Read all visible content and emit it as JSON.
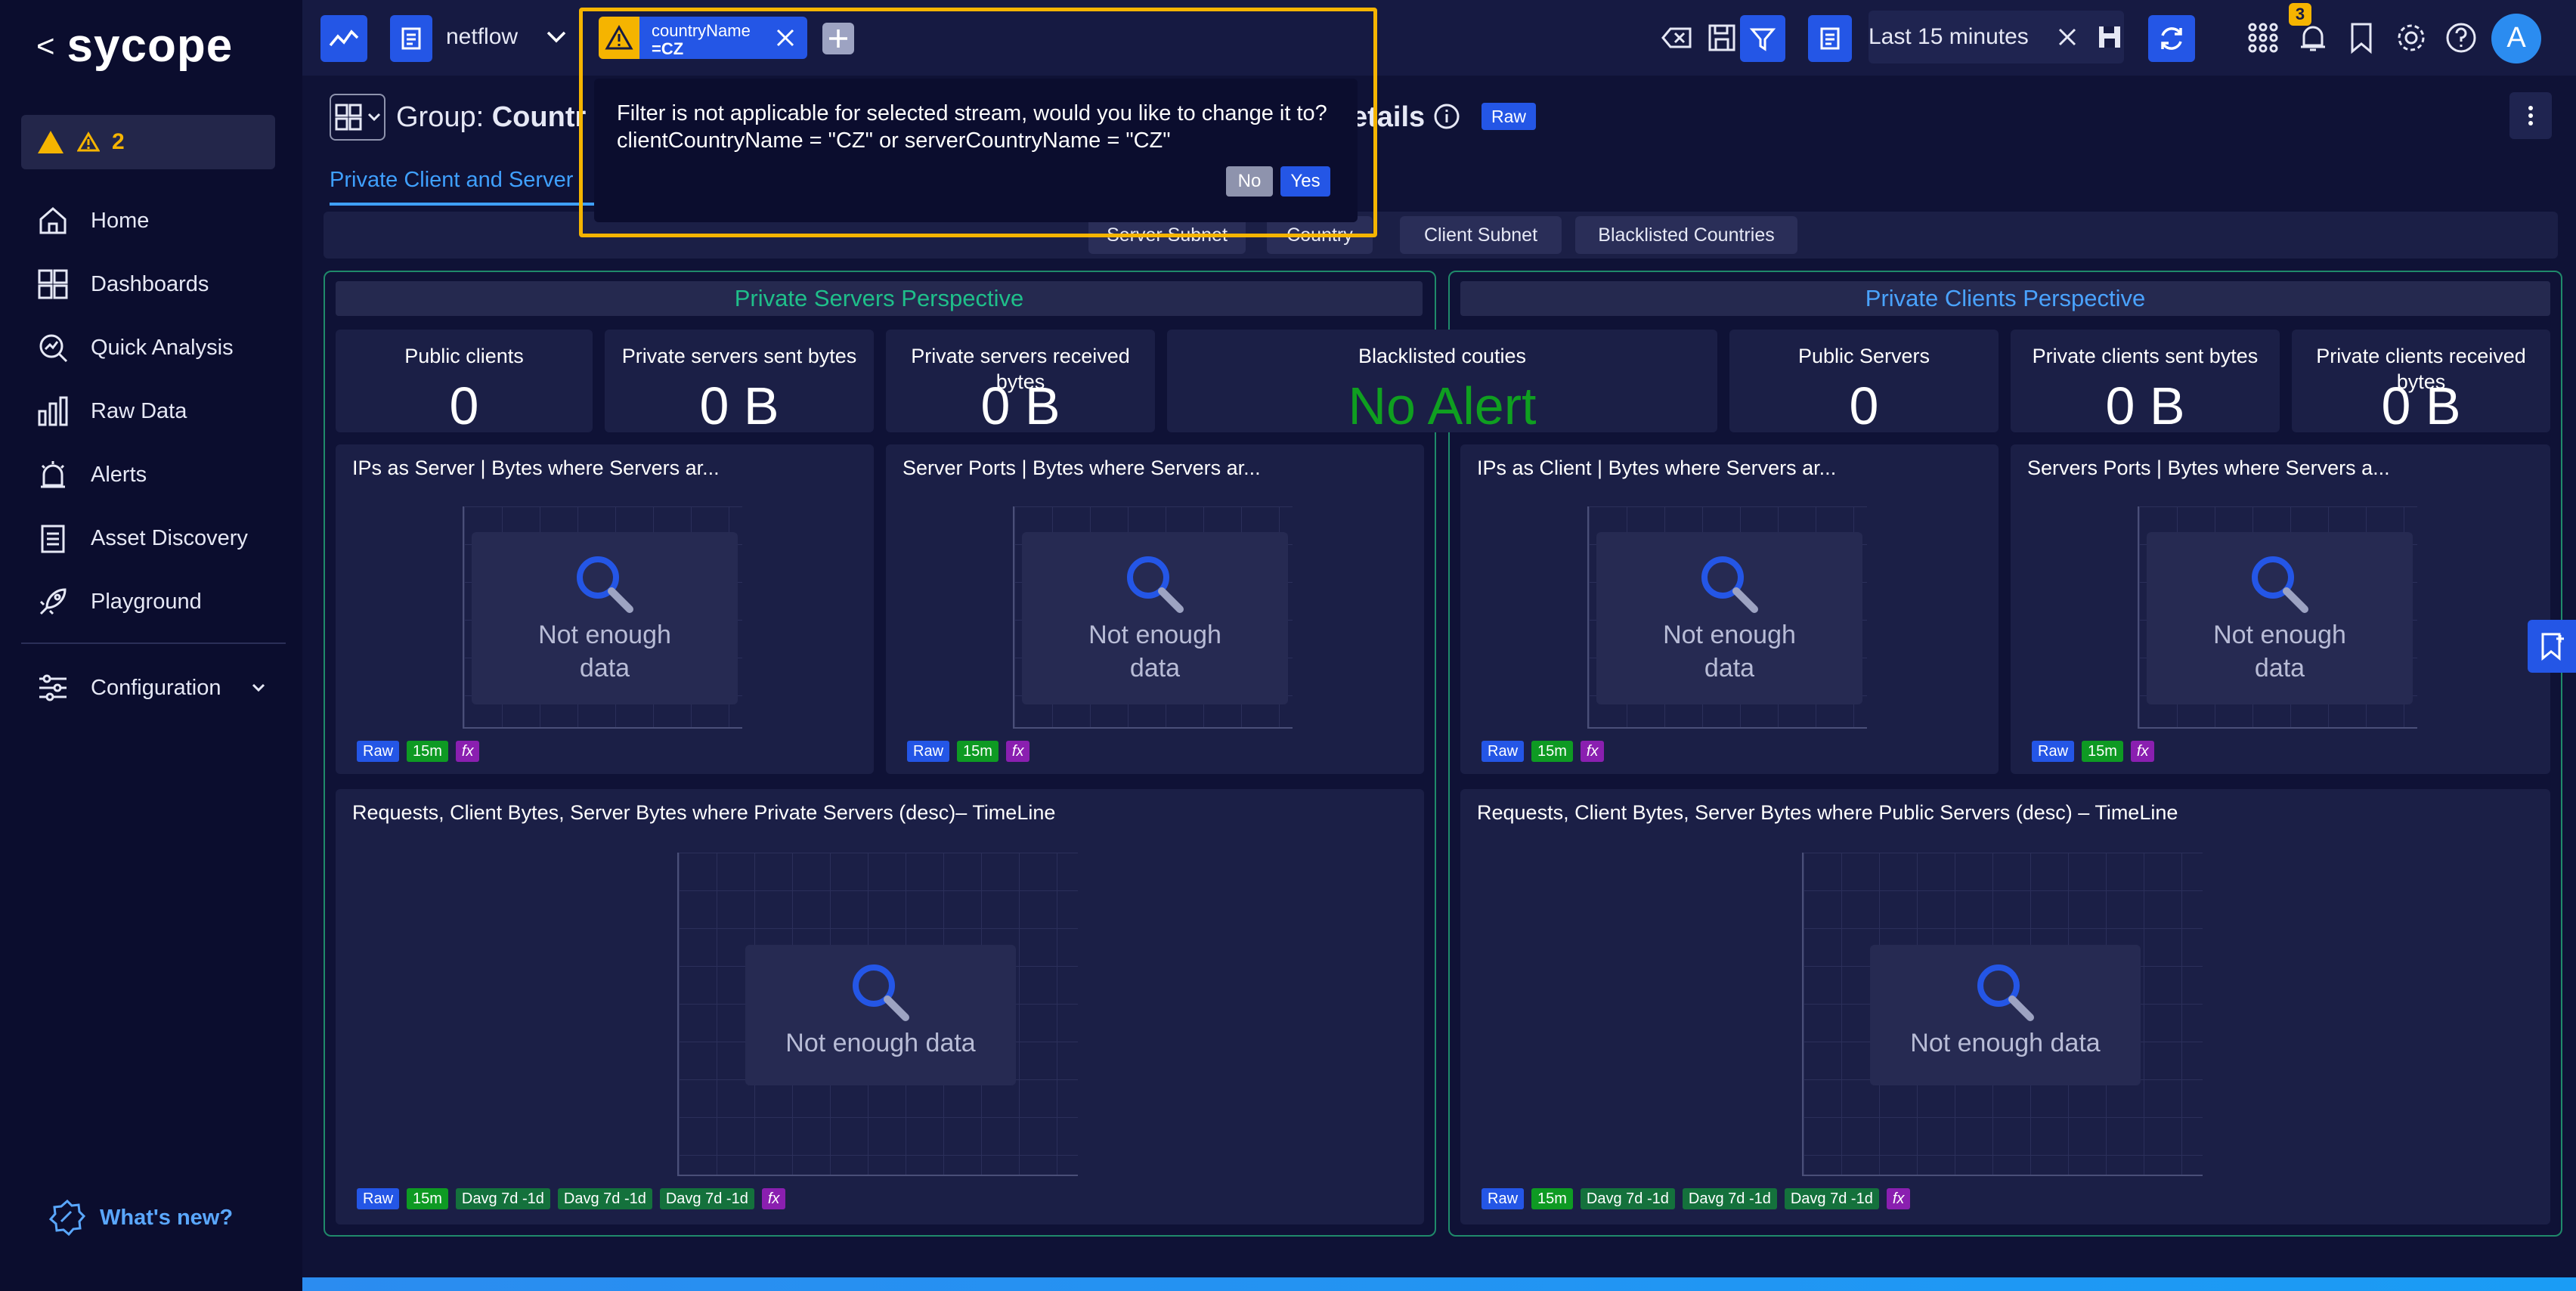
{
  "brand": {
    "name": "sycope",
    "back": "<"
  },
  "sidebar": {
    "alert_count": "2",
    "items": [
      {
        "label": "Home",
        "icon": "home-icon"
      },
      {
        "label": "Dashboards",
        "icon": "grid-icon"
      },
      {
        "label": "Quick Analysis",
        "icon": "magnify-chart-icon"
      },
      {
        "label": "Raw Data",
        "icon": "bar-chart-icon"
      },
      {
        "label": "Alerts",
        "icon": "alarm-icon"
      },
      {
        "label": "Asset Discovery",
        "icon": "clipboard-icon"
      },
      {
        "label": "Playground",
        "icon": "rocket-icon"
      }
    ],
    "configuration": "Configuration",
    "whats_new": "What's new?"
  },
  "topbar": {
    "stream": "netflow",
    "filter_field": "countryName",
    "filter_value": "=CZ",
    "time_range": "Last 15 minutes",
    "notification_count": "3",
    "avatar_initial": "A"
  },
  "dialog": {
    "line1": "Filter is not applicable for selected stream, would you like to change it to?",
    "line2": "clientCountryName = \"CZ\" or serverCountryName = \"CZ\"",
    "no": "No",
    "yes": "Yes"
  },
  "header": {
    "group_prefix": "Group: ",
    "group_name": "Countr",
    "title_tail": "etails",
    "raw": "Raw"
  },
  "tabs": {
    "active": "Private Client and Server"
  },
  "subtabs": [
    "Server Subnet",
    "Country",
    "Client Subnet",
    "Blacklisted Countries"
  ],
  "sections": {
    "left_title": "Private Servers Perspective",
    "right_title": "Private Clients Perspective"
  },
  "kpis": [
    {
      "title": "Public clients",
      "value": "0"
    },
    {
      "title": "Private servers sent bytes",
      "value": "0 B"
    },
    {
      "title": "Private servers received bytes",
      "value": "0 B"
    },
    {
      "title": "Blacklisted couties",
      "value": "No Alert"
    },
    {
      "title": "Public Servers",
      "value": "0"
    },
    {
      "title": "Private clients sent bytes",
      "value": "0 B"
    },
    {
      "title": "Private clients received bytes",
      "value": "0 B"
    }
  ],
  "panels": [
    {
      "title": "IPs as Server | Bytes where Servers ar..."
    },
    {
      "title": "Server Ports | Bytes where Servers ar..."
    },
    {
      "title": "IPs as Client | Bytes where Servers ar..."
    },
    {
      "title": "Servers Ports | Bytes where Servers a..."
    },
    {
      "title": "Requests, Client Bytes, Server Bytes where Private Servers (desc)– TimeLine"
    },
    {
      "title": "Requests, Client Bytes, Server Bytes where Public Servers (desc) – TimeLine"
    }
  ],
  "nodata": {
    "line1": "Not enough",
    "line2": "data",
    "full": "Not enough data"
  },
  "tags": {
    "raw": "Raw",
    "m15": "15m",
    "davg": "Davg 7d -1d",
    "fx": "fx"
  },
  "colors": {
    "accent": "#2456e6",
    "warning": "#f5b400",
    "positive": "#0f9f20",
    "section_border": "#1f8a6a"
  }
}
